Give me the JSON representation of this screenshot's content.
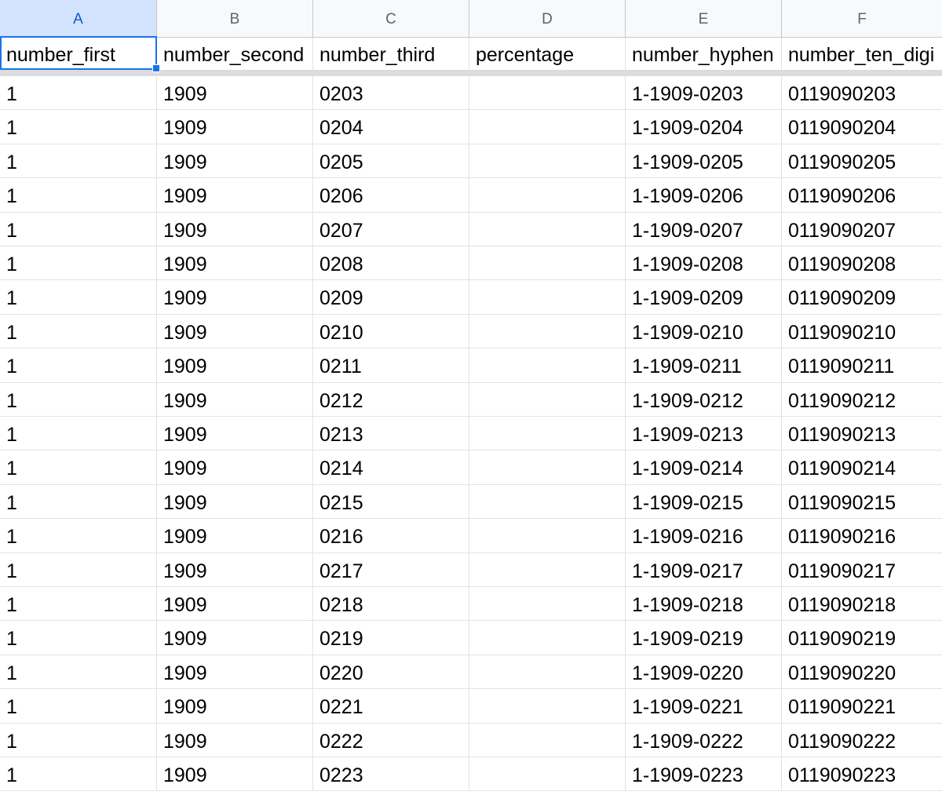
{
  "columns": [
    "A",
    "B",
    "C",
    "D",
    "E",
    "F"
  ],
  "selected_column": "A",
  "headers": [
    "number_first",
    "number_second",
    "number_third",
    "percentage",
    "number_hyphen",
    "number_ten_digi"
  ],
  "rows": [
    [
      "1",
      "1909",
      "0203",
      "",
      "1-1909-0203",
      "0119090203"
    ],
    [
      "1",
      "1909",
      "0204",
      "",
      "1-1909-0204",
      "0119090204"
    ],
    [
      "1",
      "1909",
      "0205",
      "",
      "1-1909-0205",
      "0119090205"
    ],
    [
      "1",
      "1909",
      "0206",
      "",
      "1-1909-0206",
      "0119090206"
    ],
    [
      "1",
      "1909",
      "0207",
      "",
      "1-1909-0207",
      "0119090207"
    ],
    [
      "1",
      "1909",
      "0208",
      "",
      "1-1909-0208",
      "0119090208"
    ],
    [
      "1",
      "1909",
      "0209",
      "",
      "1-1909-0209",
      "0119090209"
    ],
    [
      "1",
      "1909",
      "0210",
      "",
      "1-1909-0210",
      "0119090210"
    ],
    [
      "1",
      "1909",
      "0211",
      "",
      "1-1909-0211",
      "0119090211"
    ],
    [
      "1",
      "1909",
      "0212",
      "",
      "1-1909-0212",
      "0119090212"
    ],
    [
      "1",
      "1909",
      "0213",
      "",
      "1-1909-0213",
      "0119090213"
    ],
    [
      "1",
      "1909",
      "0214",
      "",
      "1-1909-0214",
      "0119090214"
    ],
    [
      "1",
      "1909",
      "0215",
      "",
      "1-1909-0215",
      "0119090215"
    ],
    [
      "1",
      "1909",
      "0216",
      "",
      "1-1909-0216",
      "0119090216"
    ],
    [
      "1",
      "1909",
      "0217",
      "",
      "1-1909-0217",
      "0119090217"
    ],
    [
      "1",
      "1909",
      "0218",
      "",
      "1-1909-0218",
      "0119090218"
    ],
    [
      "1",
      "1909",
      "0219",
      "",
      "1-1909-0219",
      "0119090219"
    ],
    [
      "1",
      "1909",
      "0220",
      "",
      "1-1909-0220",
      "0119090220"
    ],
    [
      "1",
      "1909",
      "0221",
      "",
      "1-1909-0221",
      "0119090221"
    ],
    [
      "1",
      "1909",
      "0222",
      "",
      "1-1909-0222",
      "0119090222"
    ],
    [
      "1",
      "1909",
      "0223",
      "",
      "1-1909-0223",
      "0119090223"
    ]
  ],
  "colors": {
    "selection": "#1a73e8",
    "header_bg": "#f8f9fa",
    "gridline": "#e2e2e2"
  }
}
